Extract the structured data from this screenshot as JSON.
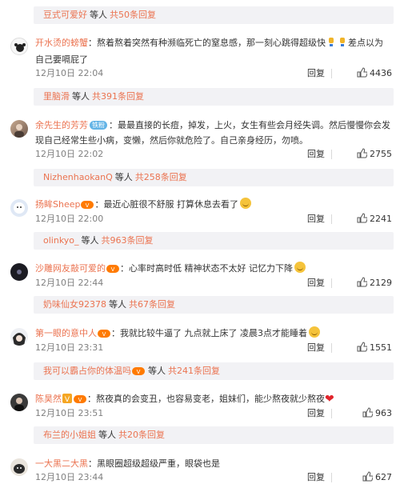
{
  "comments": [
    {
      "user": "开水烫的螃蟹",
      "text": "熬着熬着突然有种濒临死亡的窒息感，那一刻心跳得超级快",
      "text_tail": "差点以为自己要嗝屁了",
      "time": "12月10日 22:04",
      "reply_label": "回复",
      "likes": "4436",
      "avatar_icon": "crab-avatar-icon",
      "replies": {
        "name": "里脑滑",
        "and_others": "等人",
        "count": "共391条回复"
      }
    },
    {
      "user": "余先生的芳芳",
      "tag": "铁粉",
      "text": "最最直接的长痘，掉发，上火，女生有些会月经失调。然后慢慢你会发现自己经常生些小病，变懒，然后你就危险了。自己亲身经历，勿喷。",
      "time": "12月10日 22:02",
      "reply_label": "回复",
      "likes": "2755",
      "avatar_icon": "photo-avatar-icon",
      "replies": {
        "name": "NizhenhaokanQ",
        "and_others": "等人",
        "count": "共258条回复"
      }
    },
    {
      "user": "扬眸Sheep",
      "text": "最近心脏很不舒服 打算休息去看了",
      "time": "12月10日 22:00",
      "reply_label": "回复",
      "likes": "2241",
      "avatar_icon": "sheep-avatar-icon",
      "replies": {
        "name": "olinkyo_",
        "and_others": "等人",
        "count": "共963条回复"
      }
    },
    {
      "user": "沙雕网友敲可爱的",
      "text": "心率时高时低 精神状态不太好 记忆力下降",
      "time": "12月10日 22:44",
      "reply_label": "回复",
      "likes": "2129",
      "avatar_icon": "dark-avatar-icon",
      "replies": {
        "name": "奶味仙女92378",
        "and_others": "等人",
        "count": "共67条回复"
      }
    },
    {
      "user": "第一眼的意中人",
      "text": "我就比较牛逼了 九点就上床了 凌晨3点才能睡着",
      "time": "12月10日 23:31",
      "reply_label": "回复",
      "likes": "1551",
      "avatar_icon": "anime-avatar-icon",
      "replies": {
        "name": "我可以霸占你的体温吗",
        "and_others": "等人",
        "count": "共241条回复"
      }
    },
    {
      "user": "陈昊然",
      "text": "熬夜真的会变丑，也容易变老，姐妹们，能少熬夜就少熬夜",
      "time": "12月10日 23:51",
      "reply_label": "回复",
      "likes": "963",
      "avatar_icon": "portrait-avatar-icon",
      "replies": {
        "name": "布兰的小姐姐",
        "and_others": "等人",
        "count": "共20条回复"
      }
    },
    {
      "user": "一大黑二大黑",
      "text": "黑眼圈超级超级严重，眼袋也是",
      "time": "12月10日 23:44",
      "reply_label": "回复",
      "likes": "627",
      "avatar_icon": "dog-avatar-icon"
    }
  ],
  "top_replies": {
    "name": "豆式可爱好",
    "and_others": "等人",
    "count": "共50条回复"
  },
  "colors": {
    "accent": "#eb7350",
    "reply_bg": "#f2f2f5",
    "meta": "#808080"
  }
}
